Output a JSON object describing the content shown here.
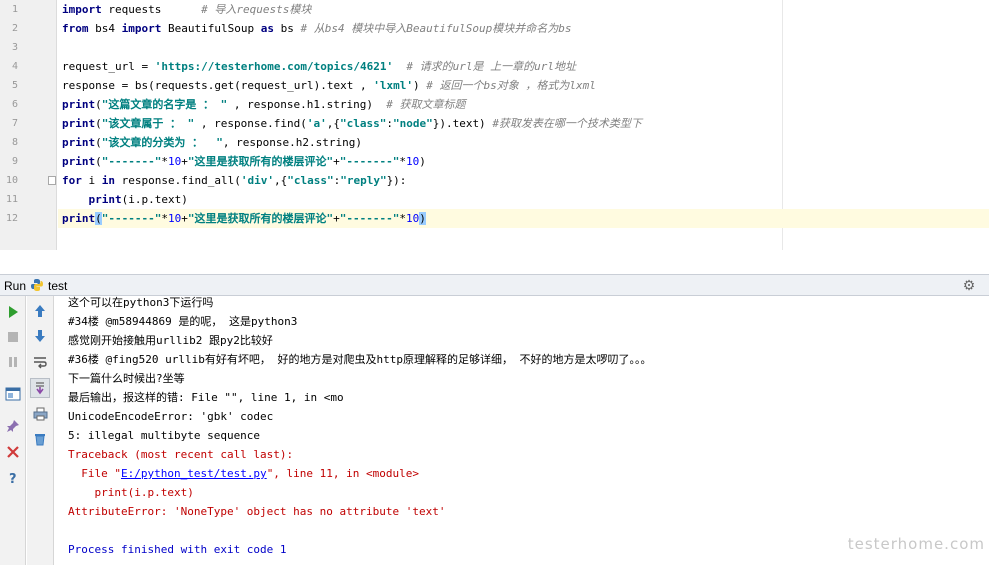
{
  "editor": {
    "line_numbers": [
      "1",
      "2",
      "3",
      "4",
      "5",
      "6",
      "7",
      "8",
      "9",
      "10",
      "11",
      "12"
    ],
    "lines": [
      [
        {
          "t": "import",
          "c": "kw"
        },
        {
          "t": " requests      "
        },
        {
          "t": "# 导入requests模块",
          "c": "cm"
        }
      ],
      [
        {
          "t": "from",
          "c": "kw"
        },
        {
          "t": " bs4 "
        },
        {
          "t": "import",
          "c": "kw"
        },
        {
          "t": " BeautifulSoup "
        },
        {
          "t": "as",
          "c": "kw"
        },
        {
          "t": " bs "
        },
        {
          "t": "# 从bs4 模块中导入BeautifulSoup模块并命名为bs",
          "c": "cm"
        }
      ],
      [],
      [
        {
          "t": "request_url = "
        },
        {
          "t": "'https://testerhome.com/topics/4621'",
          "c": "str"
        },
        {
          "t": "  "
        },
        {
          "t": "# 请求的url是 上一章的url地址",
          "c": "cm"
        }
      ],
      [
        {
          "t": "response = bs(requests.get(request_url).text , "
        },
        {
          "t": "'lxml'",
          "c": "str"
        },
        {
          "t": ") "
        },
        {
          "t": "# 返回一个bs对象 ，格式为lxml",
          "c": "cm"
        }
      ],
      [
        {
          "t": "print",
          "c": "kw"
        },
        {
          "t": "("
        },
        {
          "t": "\"这篇文章的名字是 ： \"",
          "c": "str"
        },
        {
          "t": " , response.h1.string)  "
        },
        {
          "t": "# 获取文章标题",
          "c": "cm"
        }
      ],
      [
        {
          "t": "print",
          "c": "kw"
        },
        {
          "t": "("
        },
        {
          "t": "\"该文章属于 ： \"",
          "c": "str"
        },
        {
          "t": " , response.find("
        },
        {
          "t": "'a'",
          "c": "str"
        },
        {
          "t": ",{"
        },
        {
          "t": "\"class\"",
          "c": "str"
        },
        {
          "t": ":"
        },
        {
          "t": "\"node\"",
          "c": "str"
        },
        {
          "t": "}).text) "
        },
        {
          "t": "#获取发表在哪一个技术类型下",
          "c": "cm"
        }
      ],
      [
        {
          "t": "print",
          "c": "kw"
        },
        {
          "t": "("
        },
        {
          "t": "\"该文章的分类为 ：  \"",
          "c": "str"
        },
        {
          "t": ", response.h2.string)"
        }
      ],
      [
        {
          "t": "print",
          "c": "kw"
        },
        {
          "t": "("
        },
        {
          "t": "\"-------\"",
          "c": "str"
        },
        {
          "t": "*"
        },
        {
          "t": "10",
          "c": "num"
        },
        {
          "t": "+"
        },
        {
          "t": "\"这里是获取所有的楼层评论\"",
          "c": "str"
        },
        {
          "t": "+"
        },
        {
          "t": "\"-------\"",
          "c": "str"
        },
        {
          "t": "*"
        },
        {
          "t": "10",
          "c": "num"
        },
        {
          "t": ")"
        }
      ],
      [
        {
          "t": "for",
          "c": "kw"
        },
        {
          "t": " i "
        },
        {
          "t": "in",
          "c": "kw"
        },
        {
          "t": " response.find_all("
        },
        {
          "t": "'div'",
          "c": "str"
        },
        {
          "t": ",{"
        },
        {
          "t": "\"class\"",
          "c": "str"
        },
        {
          "t": ":"
        },
        {
          "t": "\"reply\"",
          "c": "str"
        },
        {
          "t": "}):"
        }
      ],
      [
        {
          "t": "    "
        },
        {
          "t": "print",
          "c": "kw"
        },
        {
          "t": "(i.p.text)"
        }
      ],
      [
        {
          "t": "print",
          "c": "kw"
        },
        {
          "t": "(",
          "c": "brk"
        },
        {
          "t": "\"-------\"",
          "c": "str"
        },
        {
          "t": "*"
        },
        {
          "t": "10",
          "c": "num"
        },
        {
          "t": "+"
        },
        {
          "t": "\"这里是获取所有的楼层评论\"",
          "c": "str"
        },
        {
          "t": "+"
        },
        {
          "t": "\"-------\"",
          "c": "str"
        },
        {
          "t": "*"
        },
        {
          "t": "10",
          "c": "num"
        },
        {
          "t": ")",
          "c": "brk"
        }
      ]
    ]
  },
  "run_panel": {
    "label": "Run",
    "config_name": "test",
    "settings_icon": "gear-icon"
  },
  "console": {
    "lines": [
      {
        "text": "这个可以在python3下运行吗",
        "kind": "out"
      },
      {
        "text": "#34楼 @m58944869 是的呢， 这是python3",
        "kind": "out"
      },
      {
        "text": "感觉刚开始接触用urllib2 跟py2比较好",
        "kind": "out"
      },
      {
        "text": "#36楼 @fing520 urllib有好有坏吧， 好的地方是对爬虫及http原理解释的足够详细， 不好的地方是太啰叨了。。。",
        "kind": "out"
      },
      {
        "text": "下一篇什么时候出?坐等",
        "kind": "out"
      },
      {
        "text": "最后输出，报这样的错: File \"\", line 1, in <mo",
        "kind": "out"
      },
      {
        "text": "UnicodeEncodeError: 'gbk' codec",
        "kind": "out"
      },
      {
        "text": "5: illegal multibyte sequence",
        "kind": "out"
      },
      {
        "text": "Traceback (most recent call last):",
        "kind": "err"
      },
      {
        "pre": "  File \"",
        "link": "E:/python_test/test.py",
        "post": "\", line 11, in <module>",
        "kind": "err"
      },
      {
        "text": "    print(i.p.text)",
        "kind": "err"
      },
      {
        "text": "AttributeError: 'NoneType' object has no attribute 'text'",
        "kind": "err"
      },
      {
        "text": "",
        "kind": "out"
      },
      {
        "text": "Process finished with exit code 1",
        "kind": "exit"
      }
    ]
  },
  "watermark": "testerhome.com",
  "colors": {
    "keyword": "#000080",
    "string": "#008080",
    "comment": "#808080",
    "error": "#c00000",
    "run_green": "#2f9e2f"
  }
}
